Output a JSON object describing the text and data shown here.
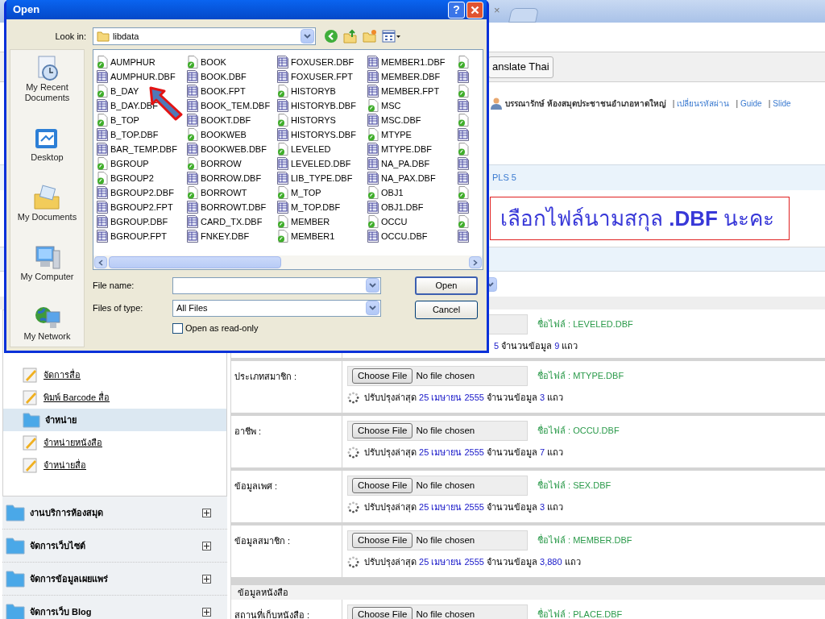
{
  "browser": {
    "tab_close": "×"
  },
  "toolbar": {
    "translate_button": "anslate Thai"
  },
  "user_bar": {
    "user": "บรรณารักษ์ ห้องสมุดประชาชนอำเภอหาดใหญ่",
    "separator": "|",
    "links": [
      "เปลี่ยนรหัสผ่าน",
      "Guide",
      "Slide"
    ]
  },
  "breadcrumb": "PLS 5",
  "annotation": "เลือกไฟล์นามสกุล **.DBF** นะคะ",
  "sidebar": {
    "items": [
      {
        "kind": "link",
        "label": "จัดการสื่อ",
        "selected": false
      },
      {
        "kind": "link",
        "label": "พิมพ์ Barcode สื่อ",
        "selected": false
      },
      {
        "kind": "folder",
        "label": "จำหน่าย",
        "selected": true
      },
      {
        "kind": "link",
        "label": "จำหน่ายหนังสือ",
        "selected": false
      },
      {
        "kind": "link",
        "label": "จำหน่ายสื่อ",
        "selected": false
      }
    ],
    "sections": [
      {
        "label": "งานบริการห้องสมุด",
        "expanded": false
      },
      {
        "label": "จัดการเว็บไซต์",
        "expanded": false
      },
      {
        "label": "จัดการข้อมูลเผยแพร่",
        "expanded": false
      },
      {
        "label": "จัดการเว็บ Blog",
        "expanded": false
      }
    ]
  },
  "form": {
    "rows": [
      {
        "kind": "partial",
        "file_label": "ชื่อไฟล์ : LEVELED.DBF",
        "update": {
          "date": "5",
          "count_label": "จำนวนข้อมูล",
          "count": "9",
          "unit": "แถว"
        }
      },
      {
        "kind": "field",
        "label": "ประเภทสมาชิก :",
        "button": "Choose File",
        "status": "No file chosen",
        "file_label": "ชื่อไฟล์ : MTYPE.DBF",
        "update": {
          "prefix": "ปรับปรุงล่าสุด",
          "date": "25 เมษายน 2555",
          "count_label": "จำนวนข้อมูล",
          "count": "3",
          "unit": "แถว"
        }
      },
      {
        "kind": "field",
        "label": "อาชีพ :",
        "button": "Choose File",
        "status": "No file chosen",
        "file_label": "ชื่อไฟล์ : OCCU.DBF",
        "update": {
          "prefix": "ปรับปรุงล่าสุด",
          "date": "25 เมษายน 2555",
          "count_label": "จำนวนข้อมูล",
          "count": "7",
          "unit": "แถว"
        }
      },
      {
        "kind": "field",
        "label": "ข้อมูลเพศ :",
        "button": "Choose File",
        "status": "No file chosen",
        "file_label": "ชื่อไฟล์ : SEX.DBF",
        "update": {
          "prefix": "ปรับปรุงล่าสุด",
          "date": "25 เมษายน 2555",
          "count_label": "จำนวนข้อมูล",
          "count": "3",
          "unit": "แถว"
        }
      },
      {
        "kind": "field",
        "label": "ข้อมูลสมาชิก :",
        "button": "Choose File",
        "status": "No file chosen",
        "file_label": "ชื่อไฟล์ : MEMBER.DBF",
        "update": {
          "prefix": "ปรับปรุงล่าสุด",
          "date": "25 เมษายน 2555",
          "count_label": "จำนวนข้อมูล",
          "count": "3,880",
          "unit": "แถว"
        }
      },
      {
        "kind": "section",
        "label": "ข้อมูลหนังสือ"
      },
      {
        "kind": "cut",
        "label": "สถานที่เก็บหนังสือ :",
        "button": "Choose File",
        "status": "No file chosen",
        "file_label": "ชื่อไฟล์ : PLACE.DBF"
      }
    ]
  },
  "dialog": {
    "title": "Open",
    "help": "?",
    "look_in_label": "Look in:",
    "look_in": "libdata",
    "places": [
      "My Recent Documents",
      "Desktop",
      "My Documents",
      "My Computer",
      "My Network"
    ],
    "columns": [
      [
        {
          "name": "AUMPHUR",
          "kind": "app"
        },
        {
          "name": "AUMPHUR.DBF",
          "kind": "table"
        },
        {
          "name": "B_DAY",
          "kind": "app"
        },
        {
          "name": "B_DAY.DBF",
          "kind": "table"
        },
        {
          "name": "B_TOP",
          "kind": "app"
        },
        {
          "name": "B_TOP.DBF",
          "kind": "table"
        },
        {
          "name": "BAR_TEMP.DBF",
          "kind": "table"
        },
        {
          "name": "BGROUP",
          "kind": "app"
        },
        {
          "name": "BGROUP2",
          "kind": "app"
        },
        {
          "name": "BGROUP2.DBF",
          "kind": "table"
        },
        {
          "name": "BGROUP2.FPT",
          "kind": "table"
        },
        {
          "name": "BGROUP.DBF",
          "kind": "table"
        },
        {
          "name": "BGROUP.FPT",
          "kind": "table"
        }
      ],
      [
        {
          "name": "BOOK",
          "kind": "app"
        },
        {
          "name": "BOOK.DBF",
          "kind": "table"
        },
        {
          "name": "BOOK.FPT",
          "kind": "table"
        },
        {
          "name": "BOOK_TEM.DBF",
          "kind": "table"
        },
        {
          "name": "BOOKT.DBF",
          "kind": "table"
        },
        {
          "name": "BOOKWEB",
          "kind": "app"
        },
        {
          "name": "BOOKWEB.DBF",
          "kind": "table"
        },
        {
          "name": "BORROW",
          "kind": "app"
        },
        {
          "name": "BORROW.DBF",
          "kind": "table"
        },
        {
          "name": "BORROWT",
          "kind": "app"
        },
        {
          "name": "BORROWT.DBF",
          "kind": "table"
        },
        {
          "name": "CARD_TX.DBF",
          "kind": "table"
        },
        {
          "name": "FNKEY.DBF",
          "kind": "table"
        }
      ],
      [
        {
          "name": "FOXUSER.DBF",
          "kind": "table"
        },
        {
          "name": "FOXUSER.FPT",
          "kind": "table"
        },
        {
          "name": "HISTORYB",
          "kind": "app"
        },
        {
          "name": "HISTORYB.DBF",
          "kind": "table"
        },
        {
          "name": "HISTORYS",
          "kind": "app"
        },
        {
          "name": "HISTORYS.DBF",
          "kind": "table"
        },
        {
          "name": "LEVELED",
          "kind": "app"
        },
        {
          "name": "LEVELED.DBF",
          "kind": "table"
        },
        {
          "name": "LIB_TYPE.DBF",
          "kind": "table"
        },
        {
          "name": "M_TOP",
          "kind": "app"
        },
        {
          "name": "M_TOP.DBF",
          "kind": "table"
        },
        {
          "name": "MEMBER",
          "kind": "app"
        },
        {
          "name": "MEMBER1",
          "kind": "app"
        }
      ],
      [
        {
          "name": "MEMBER1.DBF",
          "kind": "table"
        },
        {
          "name": "MEMBER.DBF",
          "kind": "table"
        },
        {
          "name": "MEMBER.FPT",
          "kind": "table"
        },
        {
          "name": "MSC",
          "kind": "app"
        },
        {
          "name": "MSC.DBF",
          "kind": "table"
        },
        {
          "name": "MTYPE",
          "kind": "app"
        },
        {
          "name": "MTYPE.DBF",
          "kind": "table"
        },
        {
          "name": "NA_PA.DBF",
          "kind": "table"
        },
        {
          "name": "NA_PAX.DBF",
          "kind": "table"
        },
        {
          "name": "OBJ1",
          "kind": "app"
        },
        {
          "name": "OBJ1.DBF",
          "kind": "table"
        },
        {
          "name": "OCCU",
          "kind": "app"
        },
        {
          "name": "OCCU.DBF",
          "kind": "table"
        }
      ]
    ],
    "cut_column": [
      {
        "kind": "app"
      },
      {
        "kind": "table"
      },
      {
        "kind": "app"
      },
      {
        "kind": "table"
      },
      {
        "kind": "app"
      },
      {
        "kind": "table"
      },
      {
        "kind": "app"
      },
      {
        "kind": "table"
      },
      {
        "kind": "table"
      },
      {
        "kind": "app"
      },
      {
        "kind": "table"
      },
      {
        "kind": "app"
      },
      {
        "kind": "table"
      }
    ],
    "file_name_label": "File name:",
    "files_of_type_label": "Files of type:",
    "files_of_type": "All Files",
    "read_only": {
      "label": "Open as read-only",
      "checked": false
    },
    "open_button": "Open",
    "cancel_button": "Cancel"
  }
}
